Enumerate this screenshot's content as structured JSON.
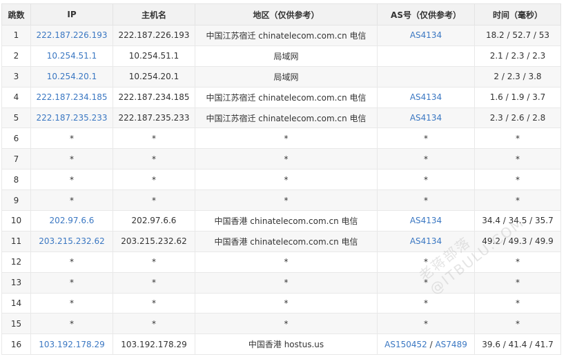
{
  "headers": [
    "跳数",
    "IP",
    "主机名",
    "地区（仅供参考）",
    "AS号（仅供参考）",
    "时间（毫秒）"
  ],
  "rows": [
    {
      "hop": "1",
      "ip": "222.187.226.193",
      "host": "222.187.226.193",
      "region": "中国江苏宿迁 chinatelecom.com.cn 电信",
      "as": [
        "AS4134"
      ],
      "time": "18.2 / 52.7 / 53"
    },
    {
      "hop": "2",
      "ip": "10.254.51.1",
      "host": "10.254.51.1",
      "region": "局域网",
      "as": [],
      "time": "2.1 / 2.3 / 2.3"
    },
    {
      "hop": "3",
      "ip": "10.254.20.1",
      "host": "10.254.20.1",
      "region": "局域网",
      "as": [],
      "time": "2 / 2.3 / 3.8"
    },
    {
      "hop": "4",
      "ip": "222.187.234.185",
      "host": "222.187.234.185",
      "region": "中国江苏宿迁 chinatelecom.com.cn 电信",
      "as": [
        "AS4134"
      ],
      "time": "1.6 / 1.9 / 3.7"
    },
    {
      "hop": "5",
      "ip": "222.187.235.233",
      "host": "222.187.235.233",
      "region": "中国江苏宿迁 chinatelecom.com.cn 电信",
      "as": [
        "AS4134"
      ],
      "time": "2.3 / 2.6 / 2.8"
    },
    {
      "hop": "6",
      "ip": "*",
      "host": "*",
      "region": "*",
      "as": [
        "*"
      ],
      "time": "*"
    },
    {
      "hop": "7",
      "ip": "*",
      "host": "*",
      "region": "*",
      "as": [
        "*"
      ],
      "time": "*"
    },
    {
      "hop": "8",
      "ip": "*",
      "host": "*",
      "region": "*",
      "as": [
        "*"
      ],
      "time": "*"
    },
    {
      "hop": "9",
      "ip": "*",
      "host": "*",
      "region": "*",
      "as": [
        "*"
      ],
      "time": "*"
    },
    {
      "hop": "10",
      "ip": "202.97.6.6",
      "host": "202.97.6.6",
      "region": "中国香港 chinatelecom.com.cn 电信",
      "as": [
        "AS4134"
      ],
      "time": "34.4 / 34.5 / 35.7"
    },
    {
      "hop": "11",
      "ip": "203.215.232.62",
      "host": "203.215.232.62",
      "region": "中国香港 chinatelecom.com.cn 电信",
      "as": [
        "AS4134"
      ],
      "time": "49.2 / 49.3 / 49.9"
    },
    {
      "hop": "12",
      "ip": "*",
      "host": "*",
      "region": "*",
      "as": [
        "*"
      ],
      "time": "*"
    },
    {
      "hop": "13",
      "ip": "*",
      "host": "*",
      "region": "*",
      "as": [
        "*"
      ],
      "time": "*"
    },
    {
      "hop": "14",
      "ip": "*",
      "host": "*",
      "region": "*",
      "as": [
        "*"
      ],
      "time": "*"
    },
    {
      "hop": "15",
      "ip": "*",
      "host": "*",
      "region": "*",
      "as": [
        "*"
      ],
      "time": "*"
    },
    {
      "hop": "16",
      "ip": "103.192.178.29",
      "host": "103.192.178.29",
      "region": "中国香港 hostus.us",
      "as": [
        "AS150452",
        "AS7489"
      ],
      "time": "39.6 / 41.4 / 41.7"
    }
  ],
  "watermark": "老蒋部落@ITBULU.COM",
  "colors": {
    "link": "#3a77c2",
    "header_bg": "#f2f2f2",
    "odd_row_bg": "#f7f7f7"
  }
}
